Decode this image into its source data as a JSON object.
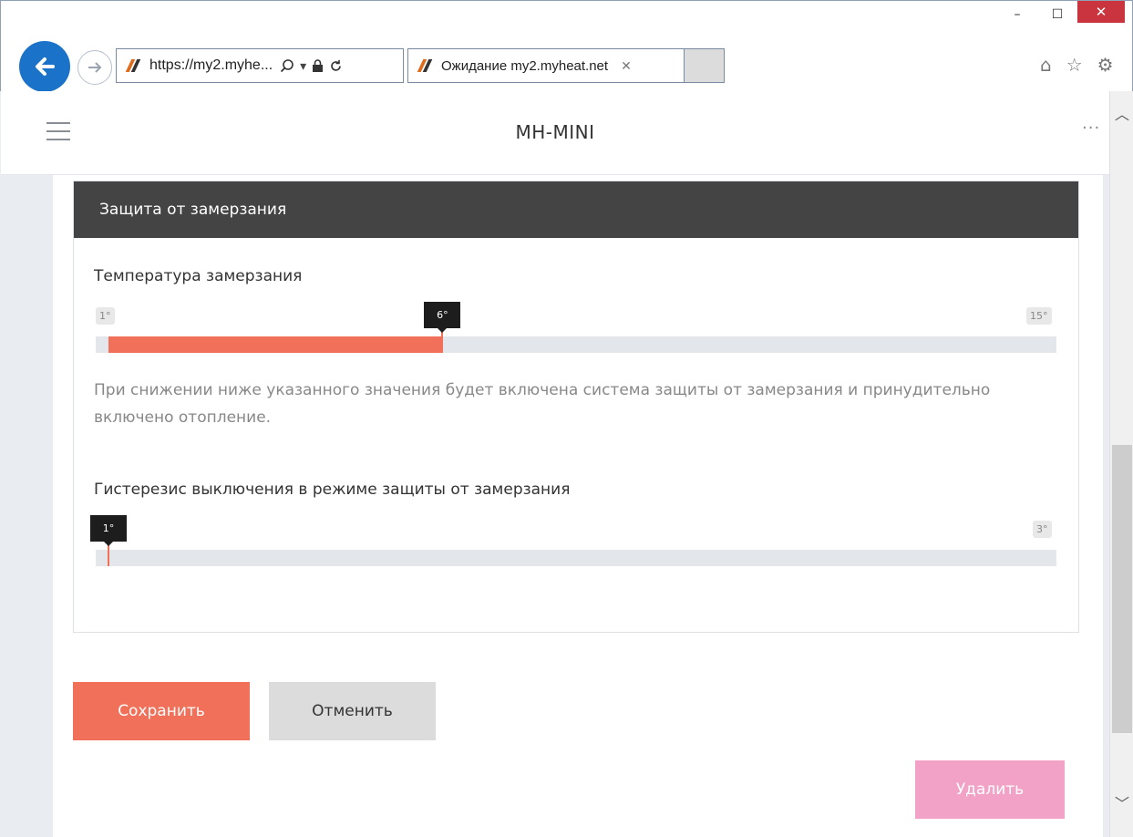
{
  "browser": {
    "address_url": "https://my2.myhe...",
    "tab_title": "Ожидание my2.myheat.net",
    "window_controls": {
      "minimize": "–",
      "maximize": "☐",
      "close": "✕"
    },
    "tab_close": "✕",
    "icons": [
      "back-icon",
      "forward-icon",
      "search-icon",
      "lock-icon",
      "refresh-icon",
      "home-icon",
      "star-icon",
      "gear-icon"
    ]
  },
  "header": {
    "title": "MH-MINI",
    "more": "···"
  },
  "section": {
    "title": "Защита от замерзания"
  },
  "freeze_temp": {
    "label": "Температура замерзания",
    "min_label": "1°",
    "max_label": "15°",
    "min": 1,
    "max": 15,
    "value": 6,
    "value_label": "6°",
    "hint": "При снижении ниже указанного значения будет включена система защиты от замерзания и принудительно включено отопление."
  },
  "hysteresis": {
    "label": "Гистерезис выключения в режиме защиты от замерзания",
    "min": 1,
    "max": 3,
    "value": 1,
    "value_label": "1°",
    "max_label": "3°"
  },
  "actions": {
    "save": "Сохранить",
    "cancel": "Отменить",
    "delete": "Удалить"
  },
  "colors": {
    "accent": "#f0705a",
    "header_bg": "#444444",
    "delete_bg": "#f2a2c6",
    "browser_blue": "#1a73c8",
    "close_red": "#c9343e"
  }
}
